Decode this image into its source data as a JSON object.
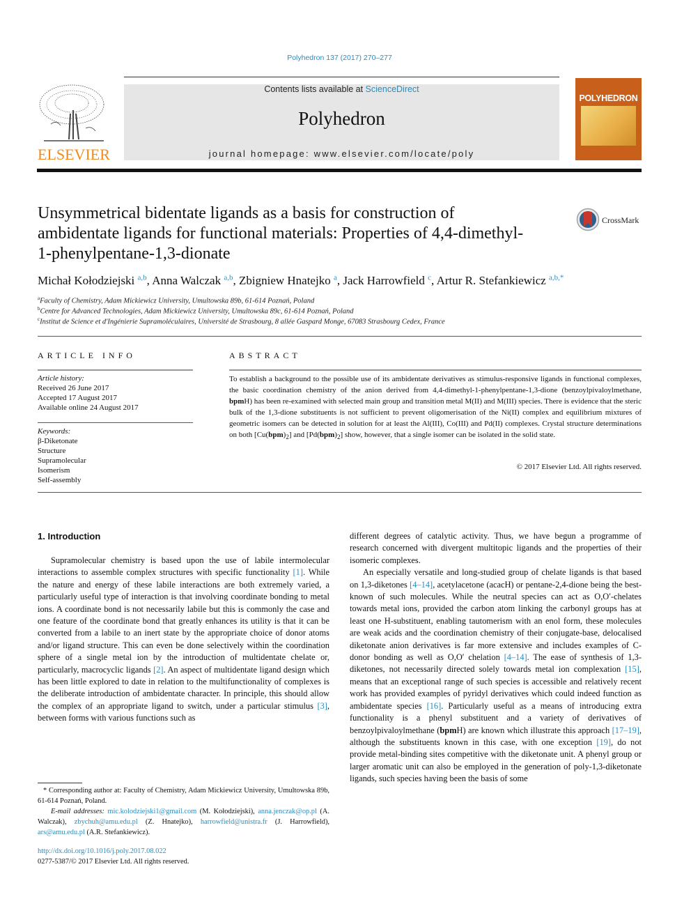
{
  "header": {
    "journal_ref": "Polyhedron 137 (2017) 270–277",
    "contents_prefix": "Contents lists available at ",
    "contents_link": "ScienceDirect",
    "journal_name": "Polyhedron",
    "homepage": "journal homepage: www.elsevier.com/locate/poly",
    "publisher_logo_text": "ELSEVIER",
    "cover_title": "POLYHEDRON",
    "colors": {
      "link": "#2a8cbf",
      "elsevier_orange": "#f08a1d",
      "banner_bg": "#e6e6e6",
      "cover_bg": "#c8601b"
    }
  },
  "article": {
    "title": "Unsymmetrical bidentate ligands as a basis for construction of ambidentate ligands for functional materials: Properties of 4,4-dimethyl-1-phenylpentane-1,3-dionate",
    "crossmark_label": "CrossMark",
    "authors": [
      {
        "name": "Michał Kołodziejski",
        "sup": "a,b",
        "sep": ", "
      },
      {
        "name": "Anna Walczak",
        "sup": "a,b",
        "sep": ", "
      },
      {
        "name": "Zbigniew Hnatejko",
        "sup": "a",
        "sep": ", "
      },
      {
        "name": "Jack Harrowfield",
        "sup": "c",
        "sep": ", "
      },
      {
        "name": "Artur R. Stefankiewicz",
        "sup": "a,b,*",
        "sep": ""
      }
    ],
    "affiliations": [
      {
        "key": "a",
        "text": "Faculty of Chemistry, Adam Mickiewicz University, Umultowska 89b, 61-614 Poznań, Poland"
      },
      {
        "key": "b",
        "text": "Centre for Advanced Technologies, Adam Mickiewicz University, Umultowska 89c, 61-614 Poznań, Poland"
      },
      {
        "key": "c",
        "text": "Institut de Science et d'Ingénierie Supramoléculaires, Université de Strasbourg, 8 allée Gaspard Monge, 67083 Strasbourg Cedex, France"
      }
    ]
  },
  "article_info": {
    "label": "ARTICLE INFO",
    "history_label": "Article history:",
    "history": [
      "Received 26 June 2017",
      "Accepted 17 August 2017",
      "Available online 24 August 2017"
    ],
    "keywords_label": "Keywords:",
    "keywords": [
      "β-Diketonate",
      "Structure",
      "Supramolecular",
      "Isomerism",
      "Self-assembly"
    ]
  },
  "abstract": {
    "label": "ABSTRACT",
    "parts": [
      "To establish a background to the possible use of its ambidentate derivatives as stimulus-responsive ligands in functional complexes, the basic coordination chemistry of the anion derived from 4,4-dimethyl-1-phenylpentane-1,3-dione (benzoylpivaloylmethane, ",
      "bpm",
      "H) has been re-examined with selected main group and transition metal M(II) and M(III) species. There is evidence that the steric bulk of the 1,3-dione substituents is not sufficient to prevent oligomerisation of the Ni(II) complex and equilibrium mixtures of geometric isomers can be detected in solution for at least the Al(III), Co(III) and Pd(II) complexes. Crystal structure determinations on both [Cu(",
      "bpm",
      ")",
      "2",
      "] and [Pd(",
      "bpm",
      ")",
      "2",
      "] show, however, that a single isomer can be isolated in the solid state."
    ],
    "copyright": "© 2017 Elsevier Ltd. All rights reserved."
  },
  "body": {
    "intro_heading": "1. Introduction",
    "left_para": [
      "Supramolecular chemistry is based upon the use of labile intermolecular interactions to assemble complex structures with specific functionality ",
      "[1]",
      ". While the nature and energy of these labile interactions are both extremely varied, a particularly useful type of interaction is that involving coordinate bonding to metal ions. A coordinate bond is not necessarily labile but this is commonly the case and one feature of the coordinate bond that greatly enhances its utility is that it can be converted from a labile to an inert state by the appropriate choice of donor atoms and/or ligand structure. This can even be done selectively within the coordination sphere of a single metal ion by the introduction of multidentate chelate or, particularly, macrocyclic ligands ",
      "[2]",
      ". An aspect of multidentate ligand design which has been little explored to date in relation to the multifunctionality of complexes is the deliberate introduction of ambidentate character. In principle, this should allow the complex of an appropriate ligand to switch, under a particular stimulus ",
      "[3]",
      ", between forms with various functions such as"
    ],
    "right_para1": "different degrees of catalytic activity. Thus, we have begun a programme of research concerned with divergent multitopic ligands and the properties of their isomeric complexes.",
    "right_para2": [
      "An especially versatile and long-studied group of chelate ligands is that based on 1,3-diketones ",
      "[4–14]",
      ", acetylacetone (acacH) or pentane-2,4-dione being the best-known of such molecules. While the neutral species can act as O,O′-chelates towards metal ions, provided the carbon atom linking the carbonyl groups has at least one H-substituent, enabling tautomerism with an enol form, these molecules are weak acids and the coordination chemistry of their conjugate-base, delocalised diketonate anion derivatives is far more extensive and includes examples of C-donor bonding as well as O,O′ chelation ",
      "[4–14]",
      ". The ease of synthesis of 1,3-diketones, not necessarily directed solely towards metal ion complexation ",
      "[15]",
      ", means that an exceptional range of such species is accessible and relatively recent work has provided examples of pyridyl derivatives which could indeed function as ambidentate species ",
      "[16]",
      ". Particularly useful as a means of introducing extra functionality is a phenyl substituent and a variety of derivatives of benzoylpivaloylmethane (",
      "bpm",
      "H) are known which illustrate this approach ",
      "[17–19]",
      ", although the substituents known in this case, with one exception ",
      "[19]",
      ", do not provide metal-binding sites competitive with the diketonate unit. A phenyl group or larger aromatic unit can also be employed in the generation of poly-1,3-diketonate ligands, such species having been the basis of some"
    ]
  },
  "footnotes": {
    "corresponding": "* Corresponding author at: Faculty of Chemistry, Adam Mickiewicz University, Umultowska 89b, 61-614 Poznań, Poland.",
    "email_label": "E-mail addresses: ",
    "emails": [
      {
        "address": "mic.kolodziejski1@gmail.com",
        "owner": " (M. Kołodziejski), "
      },
      {
        "address": "anna.jenczak@op.pl",
        "owner": " (A. Walczak), "
      },
      {
        "address": "zbychuh@amu.edu.pl",
        "owner": " (Z. Hnatejko), "
      },
      {
        "address": "harrowfield@unistra.fr",
        "owner": " (J. Harrowfield), "
      },
      {
        "address": "ars@amu.edu.pl",
        "owner": " (A.R. Stefankiewicz)."
      }
    ],
    "doi": "http://dx.doi.org/10.1016/j.poly.2017.08.022",
    "issn": "0277-5387/© 2017 Elsevier Ltd. All rights reserved."
  }
}
